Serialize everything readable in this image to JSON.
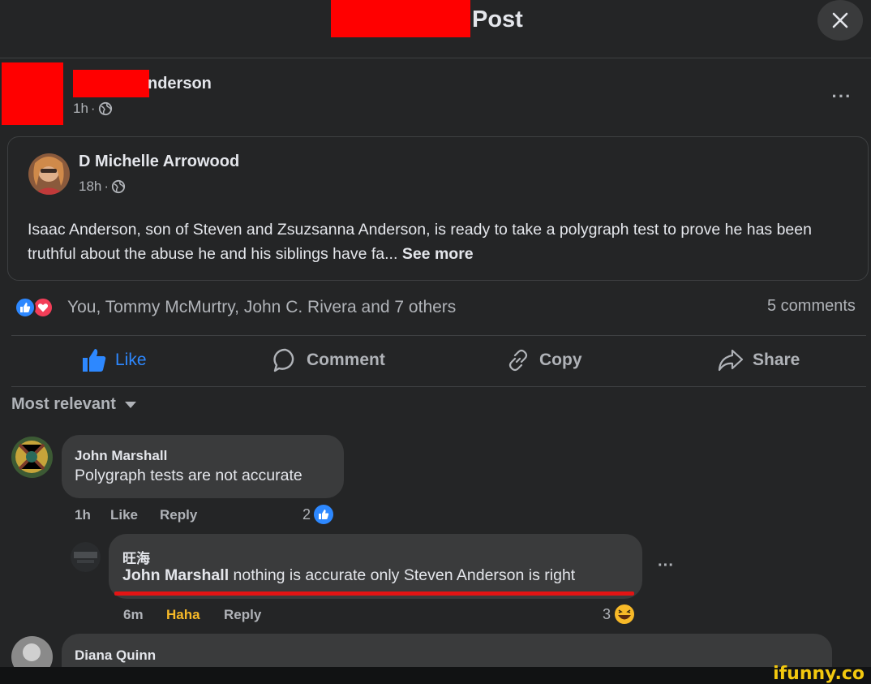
{
  "header": {
    "title": "Post",
    "close_icon": "close-icon"
  },
  "post": {
    "author_name_partial": "nderson",
    "time": "1h",
    "time_separator": "·",
    "audience_icon": "globe-icon",
    "more_label": "···"
  },
  "shared": {
    "author": "D Michelle Arrowood",
    "time": "18h",
    "time_separator": "·",
    "text": "Isaac Anderson, son of Steven and Zsuzsanna Anderson, is ready to take a polygraph test to prove he has been truthful about the abuse he and his siblings have fa...",
    "see_more": "See more"
  },
  "reactions": {
    "names": "You, Tommy McMurtry, John C. Rivera and 7 others",
    "comments": "5 comments",
    "icons": [
      "like-reaction-icon",
      "love-reaction-icon"
    ]
  },
  "actions": {
    "like": "Like",
    "comment": "Comment",
    "copy": "Copy",
    "share": "Share"
  },
  "sort_label": "Most relevant",
  "comments": [
    {
      "author": "John Marshall",
      "text": "Polygraph tests are not accurate",
      "time": "1h",
      "like": "Like",
      "reply": "Reply",
      "reaction_count": "2"
    },
    {
      "author": "旺海",
      "mention": "John Marshall",
      "text": " nothing is accurate only Steven Anderson is right",
      "time": "6m",
      "like": "Haha",
      "reply": "Reply",
      "reaction_count": "3",
      "more_label": "···"
    },
    {
      "author": "Diana Quinn"
    }
  ],
  "watermark": "ifunny.co",
  "colors": {
    "background": "#242526",
    "bubble": "#3a3b3c",
    "accent_blue": "#2d88ff",
    "haha_yellow": "#f7b928",
    "redaction": "#ff0000"
  }
}
